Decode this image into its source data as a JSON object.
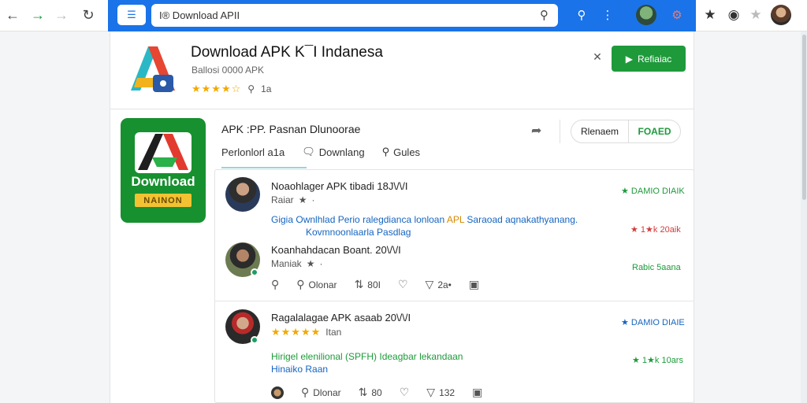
{
  "browser": {
    "address_text": "I® Download APII",
    "tabs_glyph": "☰"
  },
  "header_app": {
    "title": "Download APK K¯I Indanesa",
    "subtitle": "Ballosi 0000 APK",
    "rating_count": "1a",
    "close_glyph": "✕",
    "action_label": "Refiaiac"
  },
  "big_icon": {
    "text": "Download",
    "badge": "NAINON"
  },
  "section": {
    "title": "APK :PP.  Pasnan   Dlunoorae",
    "tabs": [
      "Perlonlorl a1a",
      "Downlang",
      "Gules"
    ],
    "pill_left": "Rlenaem",
    "pill_right": "FOAED"
  },
  "reviews": [
    {
      "name": "Noaohlager APK tibadi 18J\\/\\/I",
      "meta": "Raiar",
      "body_line1_prefix": "Gigia",
      "body_line1_a": "Ownlhlad Perio ralegdianca lonloan",
      "body_line1_b": "APL",
      "body_line1_c": "Saraoad aqnakathyanang.",
      "body_line2": "Kovmnoonlaarla Pasdlag",
      "side_top": "★ DAMIO DIAIK",
      "side_bottom": "★ 1★k 20aik",
      "sub_name": "Koanhahdacan Boant. 20\\/\\/I",
      "sub_meta": "Maniak",
      "sub_side": "Rabic 5aana",
      "actions": [
        "",
        "Olonar",
        "80I",
        "",
        "2a•",
        ""
      ]
    },
    {
      "name": "Ragalalagae APK asaab 20\\/\\/I",
      "meta": "Itan",
      "body_line1": "Hirigel elenilional (SPFH) Ideagbar lekandaan",
      "body_line2": "Hinaiko Raan",
      "side_top": "★ DAMIO DIAIE",
      "side_bottom": "★ 1★k 10ars",
      "actions": [
        "Dlonar",
        "80",
        "",
        "132",
        ""
      ]
    }
  ]
}
